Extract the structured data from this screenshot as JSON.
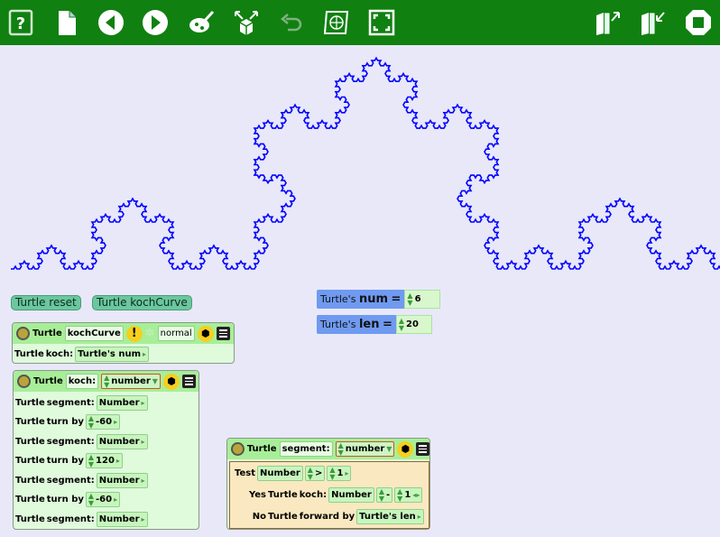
{
  "toolbar": {
    "icons": [
      "help-icon",
      "new-page-icon",
      "back-icon",
      "forward-icon",
      "paint-icon",
      "grow-shrink-icon",
      "undo-icon",
      "fullscreen-world-icon",
      "fullscreen-icon",
      "export-icon",
      "import-icon",
      "stop-icon"
    ],
    "colors": {
      "bar": "#108010",
      "icon": "#ffffff"
    }
  },
  "buttons": {
    "reset": "Turtle reset",
    "koch_curve": "Turtle kochCurve"
  },
  "watchers": [
    {
      "prefix": "Turtle's",
      "name": "num",
      "eq": "=",
      "value": "6"
    },
    {
      "prefix": "Turtle's",
      "name": "len",
      "eq": "=",
      "value": "20"
    }
  ],
  "script_koch_curve": {
    "owner": "Turtle",
    "name": "kochCurve",
    "alert": "!",
    "mode": "normal",
    "body": {
      "owner": "Turtle",
      "call": "koch:",
      "arg": "Turtle's num"
    }
  },
  "script_koch": {
    "owner": "Turtle",
    "name": "koch:",
    "param": "number",
    "rows": [
      {
        "owner": "Turtle",
        "cmd": "segment:",
        "arg": "Number"
      },
      {
        "owner": "Turtle",
        "cmd": "turn by",
        "arg": "-60"
      },
      {
        "owner": "Turtle",
        "cmd": "segment:",
        "arg": "Number"
      },
      {
        "owner": "Turtle",
        "cmd": "turn by",
        "arg": "120"
      },
      {
        "owner": "Turtle",
        "cmd": "segment:",
        "arg": "Number"
      },
      {
        "owner": "Turtle",
        "cmd": "turn by",
        "arg": "-60"
      },
      {
        "owner": "Turtle",
        "cmd": "segment:",
        "arg": "Number"
      }
    ]
  },
  "script_segment": {
    "owner": "Turtle",
    "name": "segment:",
    "param": "number",
    "test_label": "Test",
    "test_left": "Number",
    "test_op": ">",
    "test_right": "1",
    "yes_label": "Yes",
    "yes_owner": "Turtle",
    "yes_call": "koch:",
    "yes_arg": "Number",
    "yes_op": "-",
    "yes_right": "1",
    "no_label": "No",
    "no_owner": "Turtle",
    "no_cmd": "forward by",
    "no_arg": "Turtle's len"
  },
  "drawing": {
    "koch_order": 6,
    "segment_length": 20,
    "pen_color": "#0000ff"
  }
}
